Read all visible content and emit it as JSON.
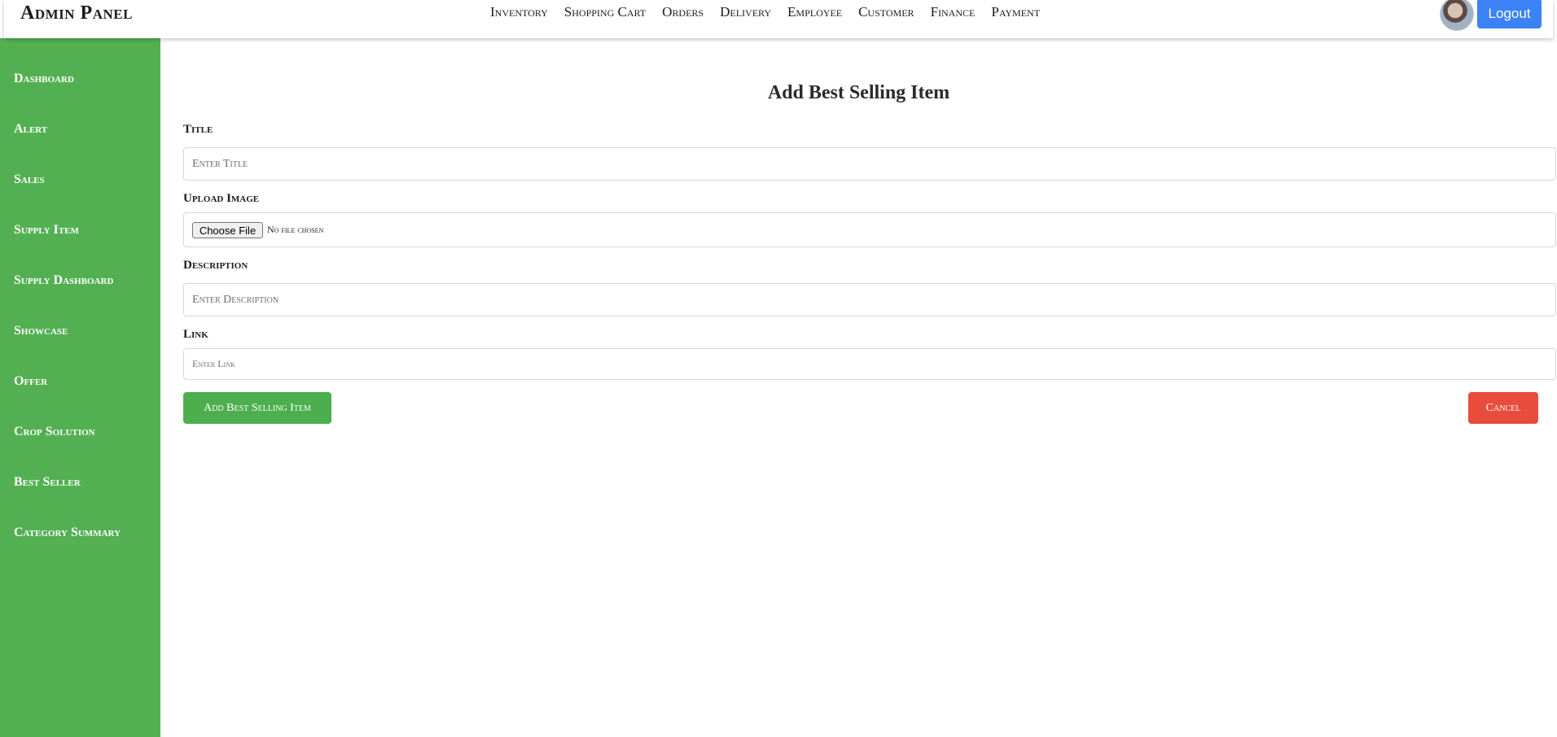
{
  "header": {
    "brand": "Admin Panel",
    "nav": [
      "Inventory",
      "Shopping Cart",
      "Orders",
      "Delivery",
      "Employee",
      "Customer",
      "Finance",
      "Payment"
    ],
    "logout_label": "Logout"
  },
  "sidebar": {
    "items": [
      {
        "label": "Dashboard"
      },
      {
        "label": "Alert"
      },
      {
        "label": "Sales"
      },
      {
        "label": "Supply Item"
      },
      {
        "label": "Supply Dashboard"
      },
      {
        "label": "Showcase"
      },
      {
        "label": "Offer"
      },
      {
        "label": "Crop Solution"
      },
      {
        "label": "Best Seller"
      },
      {
        "label": "Category Summary"
      }
    ]
  },
  "form": {
    "title": "Add Best Selling Item",
    "title_label": "Title",
    "title_placeholder": "Enter Title",
    "title_value": "",
    "image_label": "Upload Image",
    "choose_file_label": "Choose File",
    "no_file_text": "No file chosen",
    "description_label": "Description",
    "description_placeholder": "Enter Description",
    "description_value": "",
    "link_label": "Link",
    "link_placeholder": "Enter Link",
    "link_value": "",
    "submit_label": "Add Best Selling Item",
    "cancel_label": "Cancel"
  },
  "colors": {
    "sidebar": "#53b052",
    "logout_button": "#3b82f6",
    "submit_button": "#4cae4c",
    "cancel_button": "#e74c3c"
  }
}
